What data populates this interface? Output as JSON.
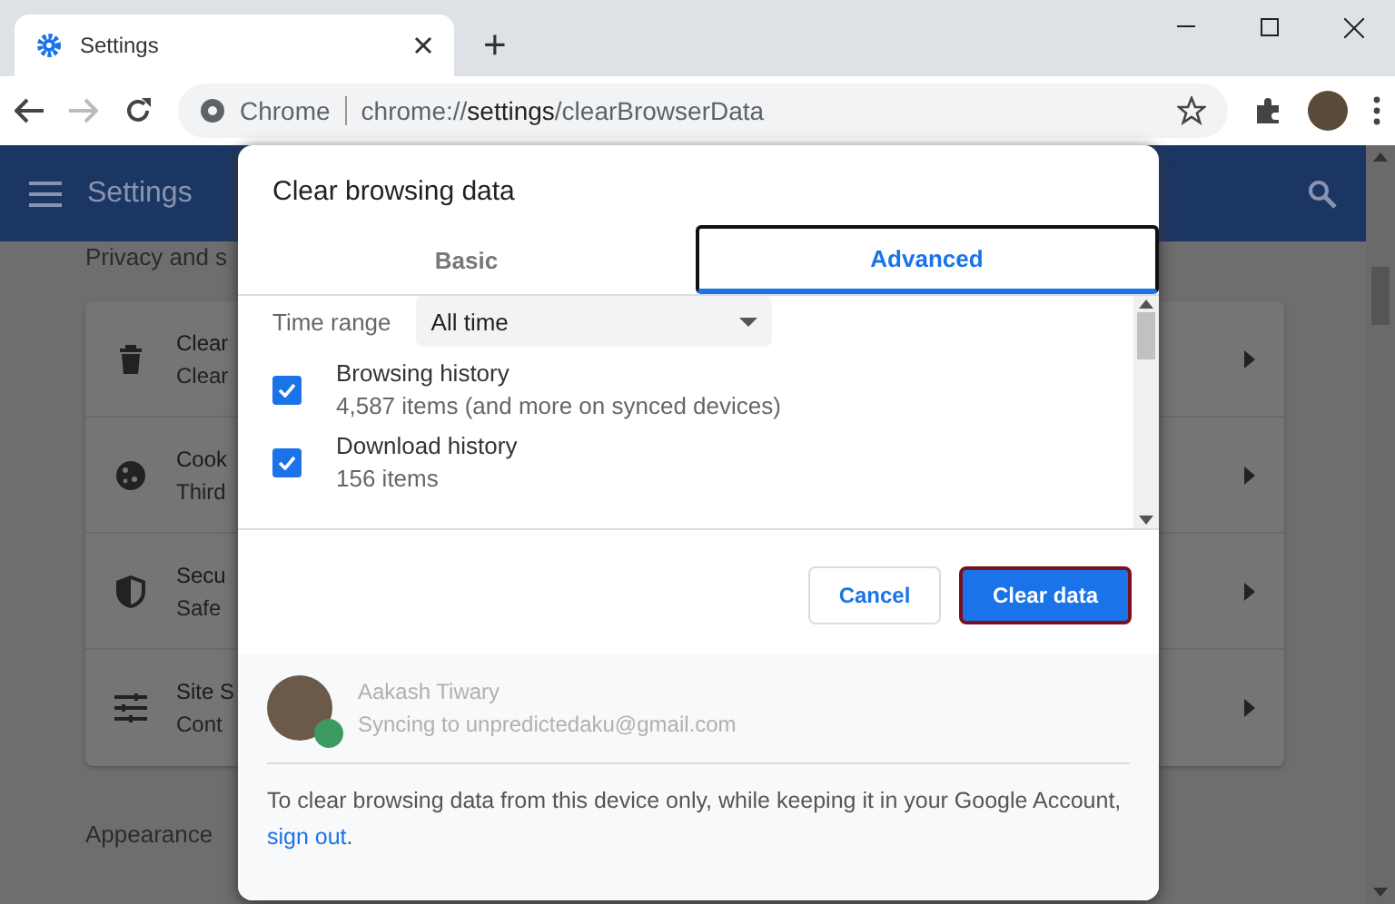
{
  "browser": {
    "tabs": [
      {
        "title": "Settings",
        "selected": true
      }
    ],
    "new_tab": "+",
    "address": {
      "site_label": "Chrome",
      "url": "chrome://**settings**/clearBrowserData"
    }
  },
  "settings_page": {
    "title": "Settings",
    "section_title": "Privacy and s",
    "rows": [
      {
        "kind": "trash",
        "title": "Clear",
        "subtitle": "Clear"
      },
      {
        "kind": "cookie",
        "title": "Cook",
        "subtitle": "Third"
      },
      {
        "kind": "shield",
        "title": "Secu",
        "subtitle": "Safe"
      },
      {
        "kind": "sliders",
        "title": "Site S",
        "subtitle": "Cont"
      }
    ],
    "section_2_title": "Appearance"
  },
  "dialog": {
    "title": "Clear browsing data",
    "tabs": [
      {
        "label": "Basic",
        "selected": false
      },
      {
        "label": "Advanced",
        "selected": true
      }
    ],
    "time_range": {
      "label": "Time range",
      "value": "All time"
    },
    "items": [
      {
        "title": "Browsing history",
        "detail": "4,587 items (and more on synced devices)",
        "checked": true
      },
      {
        "title": "Download history",
        "detail": "156 items",
        "checked": true
      }
    ],
    "buttons": [
      {
        "label": "Cancel",
        "kind": "secondary"
      },
      {
        "label": "Clear data",
        "kind": "primary"
      }
    ],
    "account": {
      "name": "Aakash Tiwary",
      "status": "Syncing to unpredictedaku@gmail.com"
    },
    "note": "To clear browsing data from this device only, while keeping it in your Google Account, ",
    "note_link": "sign out",
    "note_end": "."
  }
}
